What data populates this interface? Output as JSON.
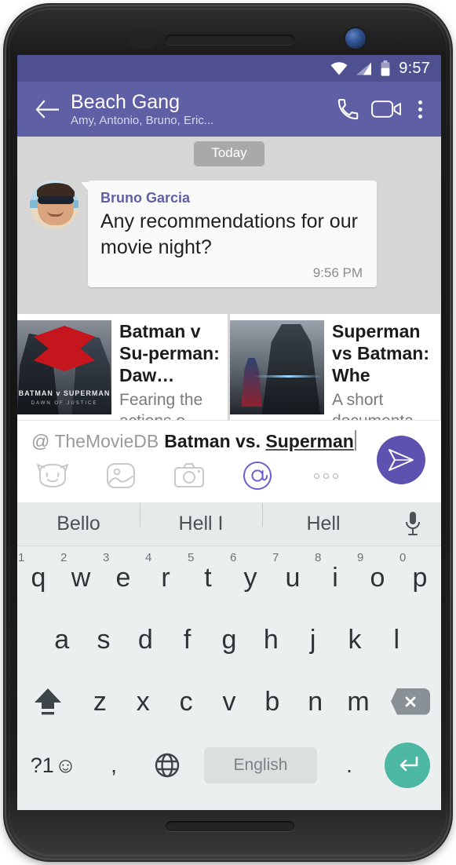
{
  "status_bar": {
    "time": "9:57",
    "icons": [
      "wifi-icon",
      "signal-icon",
      "battery-icon"
    ]
  },
  "app_bar": {
    "back_icon": "back-arrow-icon",
    "title": "Beach Gang",
    "subtitle": "Amy, Antonio, Bruno, Eric...",
    "call_icon": "phone-call-icon",
    "video_icon": "video-call-icon",
    "overflow_icon": "overflow-menu-icon"
  },
  "conversation": {
    "date_chip": "Today",
    "message": {
      "sender": "Bruno Garcia",
      "text": "Any recommendations for our movie night?",
      "time": "9:56 PM",
      "avatar": "beach-selfie-avatar"
    }
  },
  "carousel": {
    "cards": [
      {
        "poster": "batman-v-superman-poster",
        "poster_line1": "BATMAN v SUPERMAN",
        "poster_line2": "DAWN OF JUSTICE",
        "title": "Batman v Su-perman: Daw…",
        "description": "Fearing the actions o…"
      },
      {
        "poster": "superman-vs-batman-doc-poster",
        "title": "Superman vs Batman: Whe",
        "description": "A short documenta…"
      }
    ]
  },
  "composer": {
    "mention": "@ TheMovieDB",
    "query": "Batman vs. ",
    "query_underlined": "Superman",
    "tools": [
      {
        "name": "sticker-icon",
        "active": false
      },
      {
        "name": "gallery-icon",
        "active": false
      },
      {
        "name": "camera-icon",
        "active": false
      },
      {
        "name": "mention-icon",
        "active": true
      },
      {
        "name": "more-icon",
        "active": false
      }
    ],
    "send_icon": "send-icon",
    "send_color": "#5e52b0"
  },
  "keyboard": {
    "suggestions": [
      "Bello",
      "Hell I",
      "Hell"
    ],
    "mic_icon": "microphone-icon",
    "row1": [
      {
        "letter": "q",
        "num": "1"
      },
      {
        "letter": "w",
        "num": "2"
      },
      {
        "letter": "e",
        "num": "3"
      },
      {
        "letter": "r",
        "num": "4"
      },
      {
        "letter": "t",
        "num": "5"
      },
      {
        "letter": "y",
        "num": "6"
      },
      {
        "letter": "u",
        "num": "7"
      },
      {
        "letter": "i",
        "num": "8"
      },
      {
        "letter": "o",
        "num": "9"
      },
      {
        "letter": "p",
        "num": "0"
      }
    ],
    "row2": [
      "a",
      "s",
      "d",
      "f",
      "g",
      "h",
      "j",
      "k",
      "l"
    ],
    "row3": [
      "z",
      "x",
      "c",
      "v",
      "b",
      "n",
      "m"
    ],
    "shift_icon": "shift-icon",
    "backspace_icon": "backspace-icon",
    "symbols_label": "?1",
    "emoji_icon": "emoji-icon",
    "comma": ",",
    "globe_icon": "language-globe-icon",
    "spacebar_label": "English",
    "period": ".",
    "enter_icon": "enter-icon",
    "enter_color": "#4cb7a2"
  },
  "theme": {
    "status_bar_color": "#4e5090",
    "app_bar_color": "#5e5fa5",
    "accent": "#5e52b0",
    "chat_background": "#d6d6d6"
  }
}
